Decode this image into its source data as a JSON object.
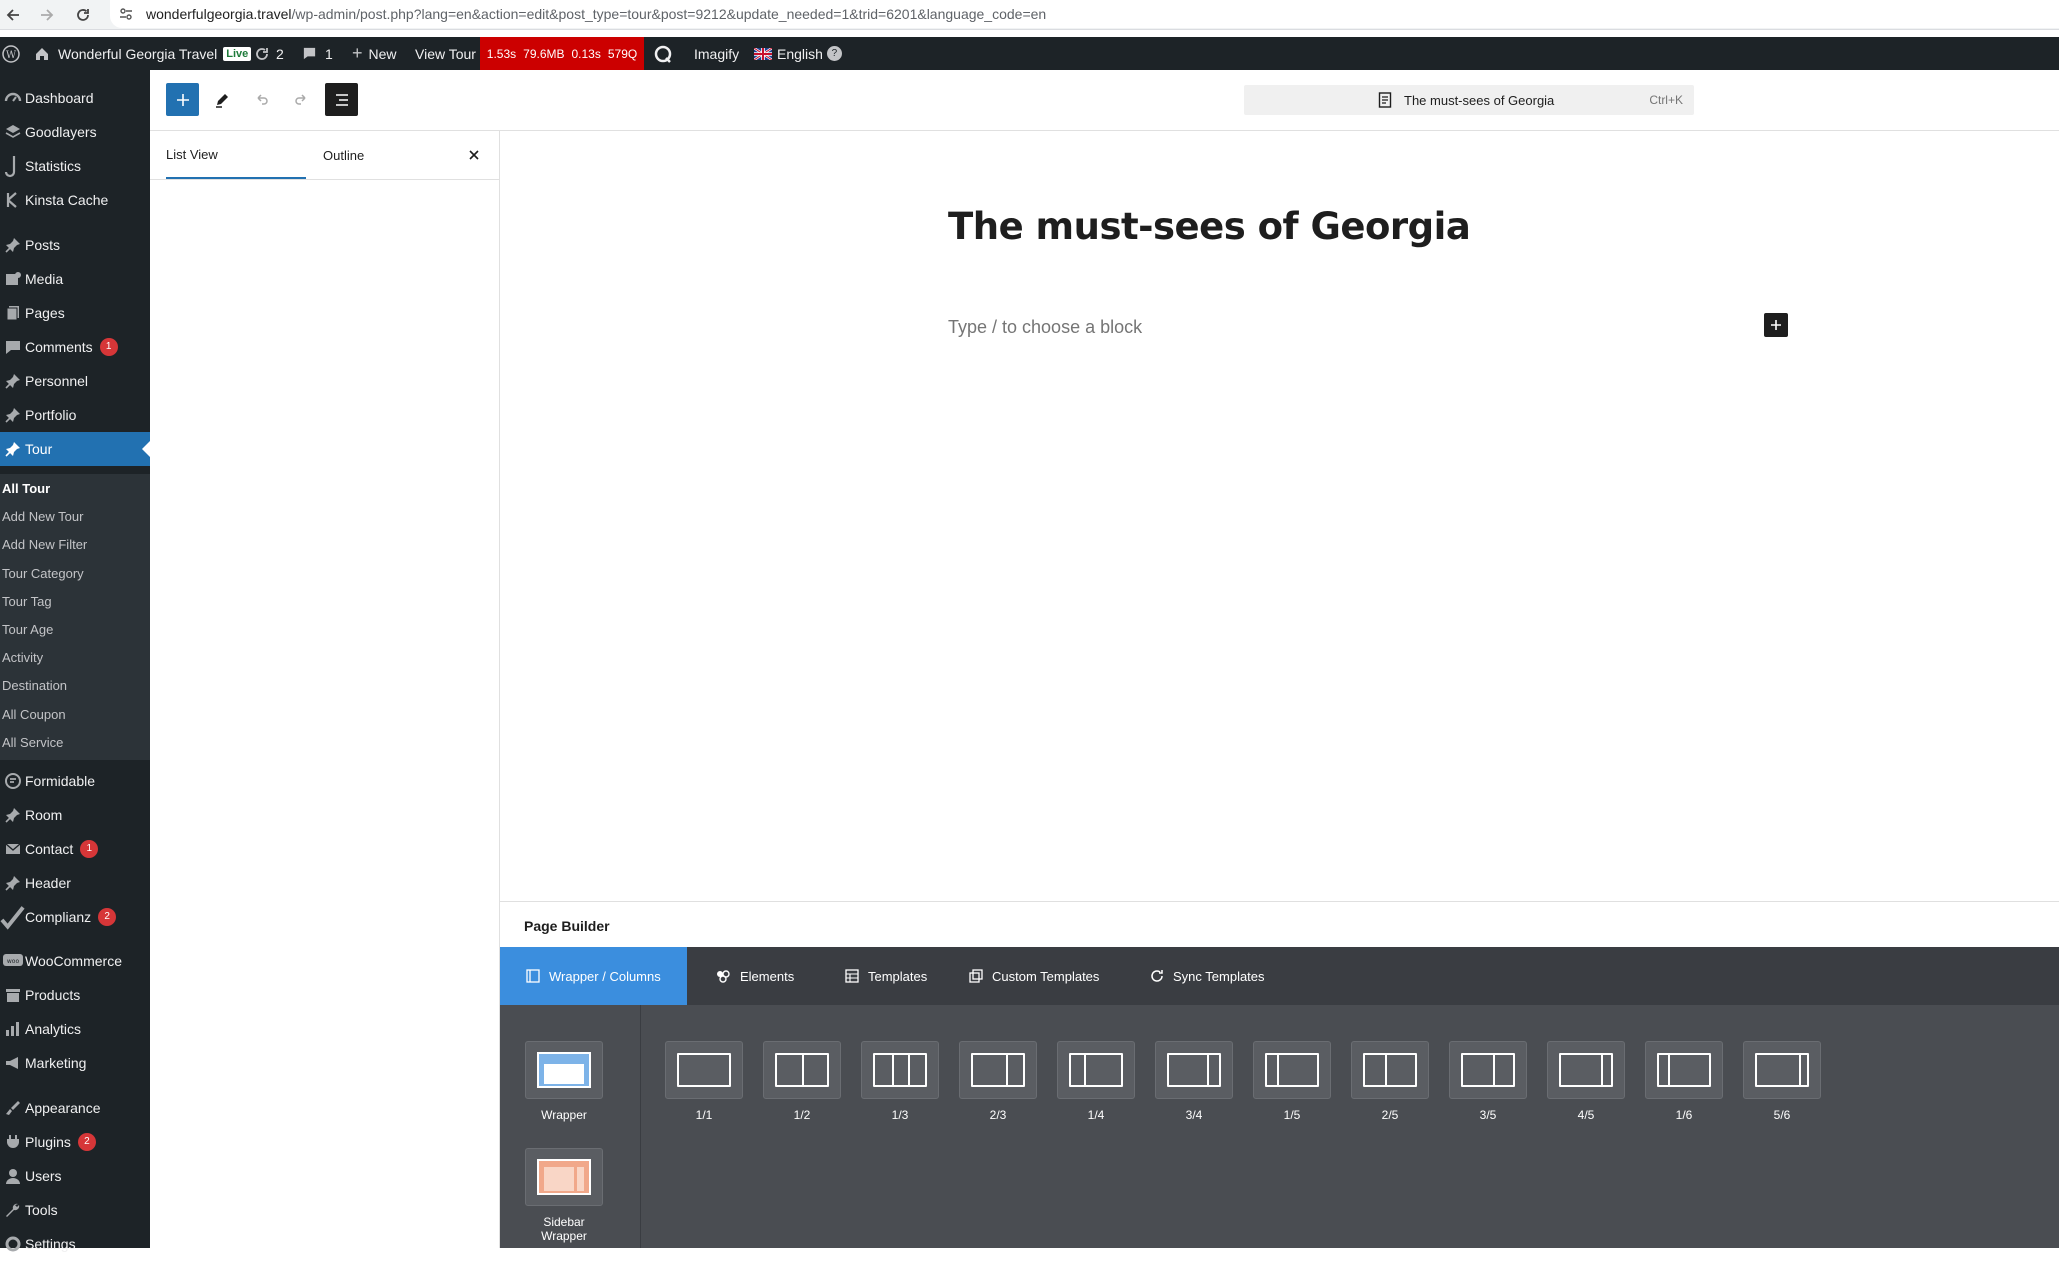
{
  "browser": {
    "url_domain": "wonderfulgeorgia.travel",
    "url_path": "/wp-admin/post.php?lang=en&action=edit&post_type=tour&post=9212&update_needed=1&trid=6201&language_code=en"
  },
  "adminbar": {
    "site_name": "Wonderful Georgia Travel",
    "live_label": "Live",
    "updates_count": "2",
    "comments_count": "1",
    "new_label": "New",
    "view_label": "View Tour",
    "perf": [
      "1.53s",
      "79.6MB",
      "0.13s",
      "579Q"
    ],
    "imagify_label": "Imagify",
    "language_label": "English",
    "language_badge": "?"
  },
  "sidebar": {
    "items": [
      {
        "label": "Dashboard",
        "icon": "dashboard-icon"
      },
      {
        "label": "Goodlayers",
        "icon": "goodlayers-icon"
      },
      {
        "label": "Statistics",
        "icon": "statistics-icon"
      },
      {
        "label": "Kinsta Cache",
        "icon": "kinsta-icon"
      },
      {
        "label": "Posts",
        "icon": "pin-icon"
      },
      {
        "label": "Media",
        "icon": "media-icon"
      },
      {
        "label": "Pages",
        "icon": "pages-icon"
      },
      {
        "label": "Comments",
        "icon": "comments-icon",
        "badge": "1"
      },
      {
        "label": "Personnel",
        "icon": "pin-icon"
      },
      {
        "label": "Portfolio",
        "icon": "pin-icon"
      },
      {
        "label": "Tour",
        "icon": "pin-icon",
        "active": true
      },
      {
        "label": "Formidable",
        "icon": "formidable-icon"
      },
      {
        "label": "Room",
        "icon": "pin-icon"
      },
      {
        "label": "Contact",
        "icon": "mail-icon",
        "badge": "1"
      },
      {
        "label": "Header",
        "icon": "pin-icon"
      },
      {
        "label": "Complianz",
        "icon": "check-icon",
        "badge": "2"
      },
      {
        "label": "WooCommerce",
        "icon": "woo-icon"
      },
      {
        "label": "Products",
        "icon": "products-icon"
      },
      {
        "label": "Analytics",
        "icon": "analytics-icon"
      },
      {
        "label": "Marketing",
        "icon": "megaphone-icon"
      },
      {
        "label": "Appearance",
        "icon": "brush-icon"
      },
      {
        "label": "Plugins",
        "icon": "plugin-icon",
        "badge": "2"
      },
      {
        "label": "Users",
        "icon": "users-icon"
      },
      {
        "label": "Tools",
        "icon": "wrench-icon"
      },
      {
        "label": "Settings",
        "icon": "settings-icon"
      }
    ],
    "submenu": [
      "All Tour",
      "Add New Tour",
      "Add New Filter",
      "Tour Category",
      "Tour Tag",
      "Tour Age",
      "Activity",
      "Destination",
      "All Coupon",
      "All Service"
    ]
  },
  "editor": {
    "command_title": "The must-sees of Georgia",
    "command_shortcut": "Ctrl+K",
    "list_view_tab": "List View",
    "outline_tab": "Outline",
    "post_title": "The must-sees of Georgia",
    "block_placeholder": "Type / to choose a block"
  },
  "page_builder": {
    "title": "Page Builder",
    "tabs": [
      {
        "label": "Wrapper / Columns",
        "icon": "columns-icon",
        "active": true
      },
      {
        "label": "Elements",
        "icon": "elements-icon"
      },
      {
        "label": "Templates",
        "icon": "templates-icon"
      },
      {
        "label": "Custom Templates",
        "icon": "custom-templates-icon"
      },
      {
        "label": "Sync Templates",
        "icon": "sync-icon"
      }
    ],
    "wrappers": [
      "Wrapper",
      "Sidebar Wrapper"
    ],
    "columns": [
      "1/1",
      "1/2",
      "1/3",
      "2/3",
      "1/4",
      "3/4",
      "1/5",
      "2/5",
      "3/5",
      "4/5",
      "1/6",
      "5/6"
    ]
  },
  "colors": {
    "accent": "#2271b1",
    "adminbar": "#1d2327",
    "perf_red": "#cc0000",
    "builder_blue": "#3b8ede"
  }
}
